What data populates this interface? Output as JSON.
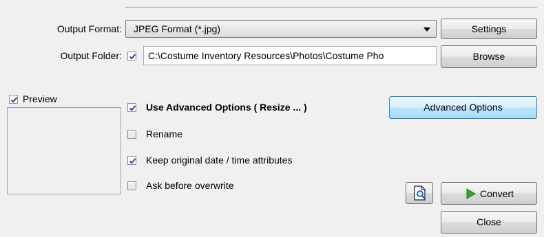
{
  "output": {
    "format_label": "Output Format:",
    "format_value": "JPEG Format (*.jpg)",
    "settings_button": "Settings",
    "folder_label": "Output Folder:",
    "folder_checked": true,
    "folder_path": "C:\\Costume Inventory Resources\\Photos\\Costume Pho",
    "browse_button": "Browse"
  },
  "preview": {
    "label": "Preview",
    "checked": true
  },
  "options": {
    "use_advanced": {
      "label": "Use Advanced Options ( Resize ... )",
      "checked": true
    },
    "rename": {
      "label": "Rename",
      "checked": false
    },
    "keep_date": {
      "label": "Keep original date / time attributes",
      "checked": true
    },
    "ask_overwrite": {
      "label": "Ask before overwrite",
      "checked": false
    },
    "advanced_button": "Advanced Options"
  },
  "actions": {
    "preview_icon": "magnifier-page-icon",
    "convert_icon": "play-arrow-icon",
    "convert_button": "Convert",
    "close_button": "Close"
  },
  "colors": {
    "check": "#2e4a8c",
    "convert_arrow": "#2fa82f",
    "advanced_button_border": "#3c7fb1"
  }
}
